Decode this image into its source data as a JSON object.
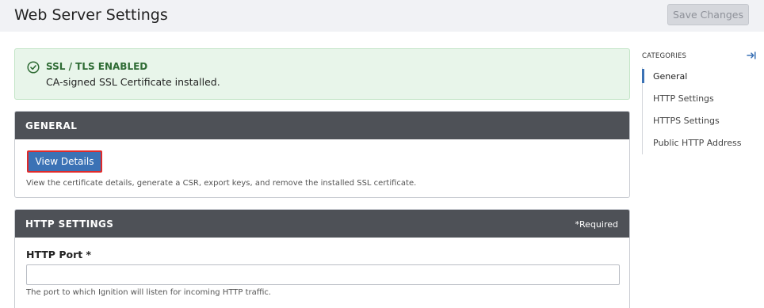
{
  "header": {
    "title": "Web Server Settings",
    "save_label": "Save Changes"
  },
  "alert": {
    "icon": "check-circle-icon",
    "title": "SSL / TLS ENABLED",
    "message": "CA-signed SSL Certificate installed."
  },
  "general": {
    "heading": "GENERAL",
    "view_details_label": "View Details",
    "description": "View the certificate details, generate a CSR, export keys, and remove the installed SSL certificate."
  },
  "http": {
    "heading": "HTTP SETTINGS",
    "required_note": "*Required",
    "port_label": "HTTP Port *",
    "port_value": "",
    "port_description": "The port to which Ignition will listen for incoming HTTP traffic."
  },
  "sidebar": {
    "heading": "CATEGORIES",
    "items": [
      {
        "label": "General",
        "active": true
      },
      {
        "label": "HTTP Settings",
        "active": false
      },
      {
        "label": "HTTPS Settings",
        "active": false
      },
      {
        "label": "Public HTTP Address",
        "active": false
      }
    ]
  },
  "colors": {
    "accent": "#3b72b5",
    "panel_header": "#4e5157",
    "success_bg": "#e8f5ea",
    "success_text": "#2e6b34",
    "highlight_border": "#e02a2a"
  }
}
